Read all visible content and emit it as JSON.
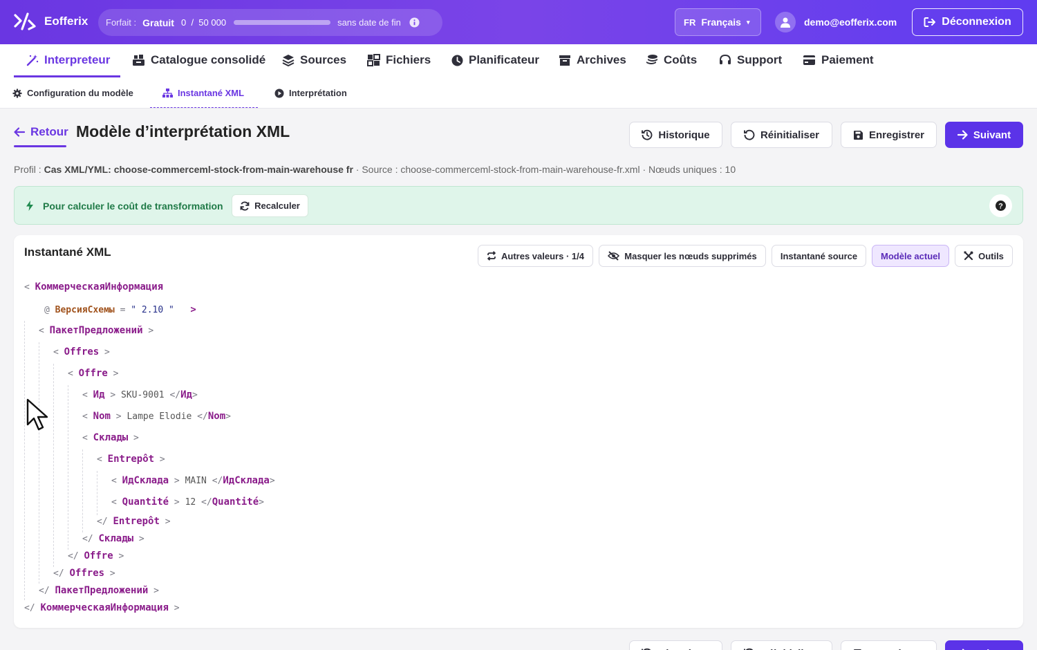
{
  "app": {
    "name": "Eofferix"
  },
  "plan": {
    "label": "Forfait :",
    "value": "Gratuit",
    "used": "0",
    "separator": "/",
    "limit": "50 000",
    "usage_fraction": 0,
    "end": "sans date de fin"
  },
  "lang": {
    "code": "FR",
    "label": "Français",
    "caret": "▾"
  },
  "user": {
    "email": "demo@eofferix.com"
  },
  "logout": {
    "label": "Déconnexion"
  },
  "nav": {
    "items": [
      {
        "label": "Interpreteur",
        "icon": "magic-wand-icon"
      },
      {
        "label": "Catalogue consolidé",
        "icon": "catalog-icon"
      },
      {
        "label": "Sources",
        "icon": "layers-icon"
      },
      {
        "label": "Fichiers",
        "icon": "files-icon"
      },
      {
        "label": "Planificateur",
        "icon": "clock-icon"
      },
      {
        "label": "Archives",
        "icon": "archive-icon"
      },
      {
        "label": "Coûts",
        "icon": "coins-icon"
      },
      {
        "label": "Support",
        "icon": "headset-icon"
      },
      {
        "label": "Paiement",
        "icon": "card-icon"
      }
    ]
  },
  "subnav": {
    "items": [
      {
        "label": "Configuration du modèle",
        "icon": "gear-icon"
      },
      {
        "label": "Instantané XML",
        "icon": "hierarchy-icon"
      },
      {
        "label": "Interprétation",
        "icon": "play-icon"
      }
    ]
  },
  "header": {
    "back": "Retour",
    "title": "Modèle d’interprétation XML",
    "buttons": {
      "history": "Historique",
      "reset": "Réinitialiser",
      "save": "Enregistrer",
      "next": "Suivant"
    }
  },
  "meta": {
    "profile_label": "Profil :",
    "profile_value": "Cas XML/YML: choose-commerceml-stock-from-main-warehouse fr",
    "source_label": "· Source :",
    "source_value": "choose-commerceml-stock-from-main-warehouse-fr.xml",
    "nodes_label": "· Nœuds uniques :",
    "nodes_value": "10"
  },
  "alert": {
    "text": "Pour calculer le coût de transformation",
    "button": "Recalculer",
    "help": "?"
  },
  "card": {
    "title": "Instantané XML",
    "buttons": {
      "other_values": "Autres valeurs · 1/4",
      "hide_deleted": "Masquer les nœuds supprimés",
      "source_snapshot": "Instantané source",
      "current_model": "Modèle actuel",
      "tools": "Outils"
    }
  },
  "xml": {
    "root": "КоммерческаяИнформация",
    "attr_name": "ВерсияСхемы",
    "attr_value": "2.10",
    "package": "ПакетПредложений",
    "offres": "Offres",
    "offre": "Offre",
    "id_tag": "Ид",
    "id_value": "SKU-9001",
    "nom_tag": "Nom",
    "nom_value": "Lampe Elodie",
    "warehouses": "Склады",
    "warehouse": "Entrepôt",
    "wh_id_tag": "ИдСклада",
    "wh_id_value": "MAIN",
    "qty_tag": "Quantité",
    "qty_value": "12"
  }
}
